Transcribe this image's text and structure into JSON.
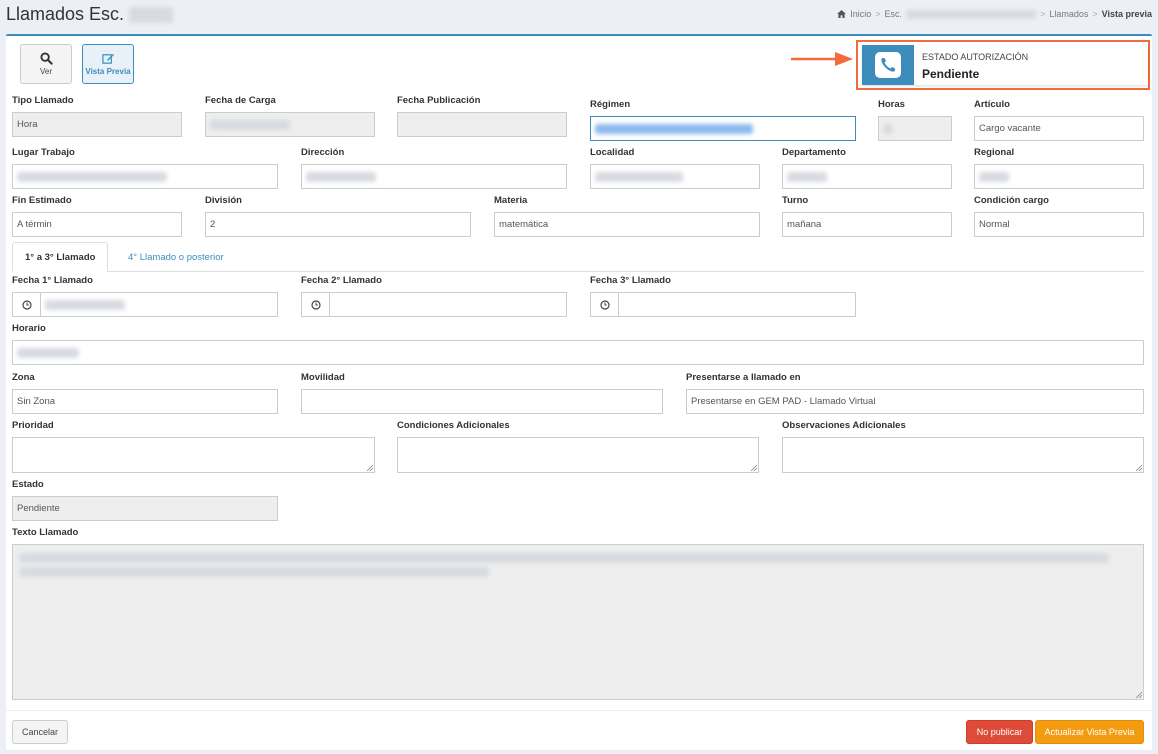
{
  "header": {
    "title": "Llamados Esc.",
    "breadcrumb": {
      "home": "Inicio",
      "school": "Esc.",
      "llamados": "Llamados",
      "current": "Vista previa"
    }
  },
  "toolbar": {
    "view_label": "Ver",
    "preview_label": "Vista Previa"
  },
  "status": {
    "label": "ESTADO AUTORIZACIÓN",
    "value": "Pendiente",
    "icon": "phone-icon",
    "accent": "#3c8dbc",
    "highlight": "#f36b3c"
  },
  "form": {
    "tipo_llamado": {
      "label": "Tipo Llamado",
      "value": "Hora"
    },
    "fecha_carga": {
      "label": "Fecha de Carga",
      "value": ""
    },
    "fecha_publicacion": {
      "label": "Fecha Publicación",
      "value": ""
    },
    "regimen": {
      "label": "Régimen",
      "value": ""
    },
    "horas": {
      "label": "Horas",
      "value": ""
    },
    "articulo": {
      "label": "Artículo",
      "value": "Cargo vacante"
    },
    "lugar_trabajo": {
      "label": "Lugar Trabajo",
      "value": ""
    },
    "direccion": {
      "label": "Dirección",
      "value": ""
    },
    "localidad": {
      "label": "Localidad",
      "value": ""
    },
    "departamento": {
      "label": "Departamento",
      "value": ""
    },
    "regional": {
      "label": "Regional",
      "value": ""
    },
    "fin_estimado": {
      "label": "Fin Estimado",
      "value": "A términ"
    },
    "division": {
      "label": "División",
      "value": "2"
    },
    "materia": {
      "label": "Materia",
      "value": "matemática"
    },
    "turno": {
      "label": "Turno",
      "value": "mañana"
    },
    "condicion_cargo": {
      "label": "Condición cargo",
      "value": "Normal"
    },
    "fecha1": {
      "label": "Fecha 1° Llamado",
      "value": ""
    },
    "fecha2": {
      "label": "Fecha 2° Llamado",
      "value": ""
    },
    "fecha3": {
      "label": "Fecha 3° Llamado",
      "value": ""
    },
    "horario": {
      "label": "Horario",
      "value": ""
    },
    "zona": {
      "label": "Zona",
      "value": "Sin Zona"
    },
    "movilidad": {
      "label": "Movilidad",
      "value": ""
    },
    "presentarse": {
      "label": "Presentarse a llamado en",
      "value": "Presentarse en GEM PAD - Llamado Virtual"
    },
    "prioridad": {
      "label": "Prioridad"
    },
    "condiciones": {
      "label": "Condiciones Adicionales"
    },
    "observaciones": {
      "label": "Observaciones Adicionales"
    },
    "estado": {
      "label": "Estado",
      "value": "Pendiente"
    },
    "texto": {
      "label": "Texto Llamado"
    }
  },
  "tabs": [
    {
      "label": "1° a 3° Llamado",
      "active": true
    },
    {
      "label": "4° Llamado o posterior",
      "active": false
    }
  ],
  "actions": {
    "cancel": "Cancelar",
    "no_publish": "No publicar",
    "update_preview": "Actualizar Vista Previa"
  }
}
